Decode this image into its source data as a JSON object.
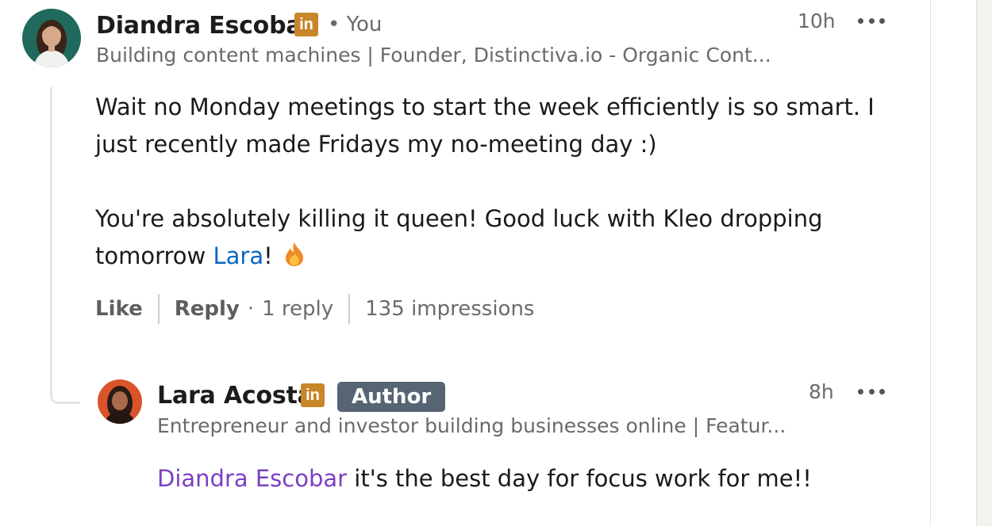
{
  "comment": {
    "author_name": "Diandra Escobar",
    "linkedin_badge": "in",
    "you_label": "• You",
    "headline": "Building content machines | Founder, Distinctiva.io - Organic Cont...",
    "time": "10h",
    "body_line1": "Wait no Monday meetings to start the week efficiently is so smart. I",
    "body_line2": "just recently made Fridays my no-meeting day :)",
    "body_line3": "You're absolutely killing it queen! Good luck with Kleo dropping",
    "body_line4_prefix": "tomorrow ",
    "mention": "Lara",
    "body_line4_suffix": "!",
    "flame_icon": "fire-emoji",
    "actions": {
      "like": "Like",
      "reply": "Reply",
      "dot": "·",
      "reply_count": "1 reply",
      "impressions": "135 impressions"
    }
  },
  "reply": {
    "author_name": "Lara Acosta",
    "linkedin_badge": "in",
    "author_tag": "Author",
    "headline": "Entrepreneur and investor building businesses online | Featur...",
    "time": "8h",
    "mention": "Diandra Escobar",
    "text": " it's the best day for focus work for me!!"
  },
  "colors": {
    "linkedin_badge": "#c78629",
    "mention_blue": "#0a66c2",
    "mention_purple": "#7b3fc4",
    "author_badge_bg": "#566473"
  }
}
